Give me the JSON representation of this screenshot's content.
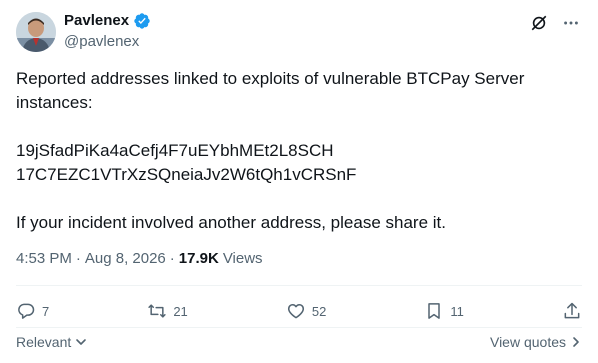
{
  "author": {
    "display_name": "Pavlenex",
    "handle": "@pavlenex",
    "verified": true
  },
  "tweet": {
    "line1": "Reported addresses linked to exploits of vulnerable BTCPay Server instances:",
    "address1": "19jSfadPiKa4aCefj4F7uEYbhMEt2L8SCH",
    "address2": "17C7EZC1VTrXzSQneiaJv2W6tQh1vCRSnF",
    "line2": "If your incident involved another address, please share it."
  },
  "meta": {
    "time": "4:53 PM",
    "separator": "·",
    "date": "Aug 8, 2026",
    "dot": "·",
    "views_count": "17.9K",
    "views_label": "Views"
  },
  "actions": {
    "replies": "7",
    "reposts": "21",
    "likes": "52",
    "bookmarks": "11"
  },
  "bottom": {
    "relevant_label": "Relevant",
    "view_quotes_label": "View quotes"
  },
  "colors": {
    "verified": "#1d9bf0",
    "secondary_text": "#536471",
    "primary_text": "#0f1419"
  }
}
